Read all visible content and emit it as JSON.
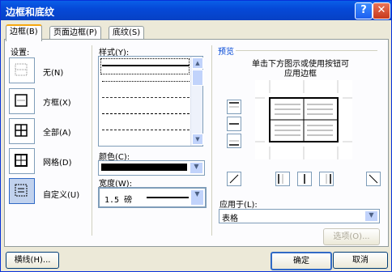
{
  "window": {
    "title": "边框和底纹"
  },
  "tabs": [
    {
      "label": "边框(B)"
    },
    {
      "label": "页面边框(P)"
    },
    {
      "label": "底纹(S)"
    }
  ],
  "settings": {
    "header": "设置:",
    "items": [
      {
        "label": "无(N)"
      },
      {
        "label": "方框(X)"
      },
      {
        "label": "全部(A)"
      },
      {
        "label": "网格(D)"
      },
      {
        "label": "自定义(U)"
      }
    ]
  },
  "style": {
    "header": "样式(Y):"
  },
  "color": {
    "label": "颜色(C):",
    "value": "#000000"
  },
  "width": {
    "label": "宽度(W):",
    "value": "1.5 磅"
  },
  "preview": {
    "header": "预览",
    "hint_line1": "单击下方图示或使用按钮可",
    "hint_line2": "应用边框"
  },
  "apply_to": {
    "label": "应用于(L):",
    "value": "表格"
  },
  "buttons": {
    "options": "选项(O)...",
    "lines": "横线(H)...",
    "ok": "确定",
    "cancel": "取消"
  }
}
